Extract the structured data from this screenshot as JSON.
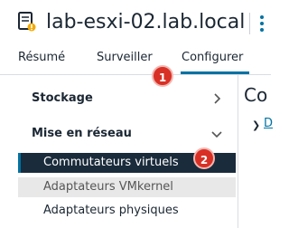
{
  "header": {
    "host_name": "lab-esxi-02.lab.local",
    "host_icon": "host-server-icon",
    "more_icon": "vertical-ellipsis-icon"
  },
  "tabs": [
    {
      "label": "Résumé",
      "active": false
    },
    {
      "label": "Surveiller",
      "active": false
    },
    {
      "label": "Configurer",
      "active": true
    }
  ],
  "sidebar": {
    "groups": [
      {
        "label": "Stockage",
        "expanded": false,
        "icon": "chevron-right-icon"
      },
      {
        "label": "Mise en réseau",
        "expanded": true,
        "icon": "chevron-down-icon",
        "items": [
          {
            "label": "Commutateurs virtuels",
            "selected": true
          },
          {
            "label": "Adaptateurs VMkernel",
            "selected": false
          },
          {
            "label": "Adaptateurs physiques",
            "selected": false
          }
        ]
      }
    ]
  },
  "content": {
    "title_partial": "Co",
    "first_link_partial": "D"
  },
  "annotations": [
    {
      "number": "1"
    },
    {
      "number": "2"
    }
  ],
  "colors": {
    "accent": "#0072a3",
    "selected_bg": "#1a2b3b",
    "hover_bg": "#e8e8e8",
    "badge": "#d93025"
  }
}
